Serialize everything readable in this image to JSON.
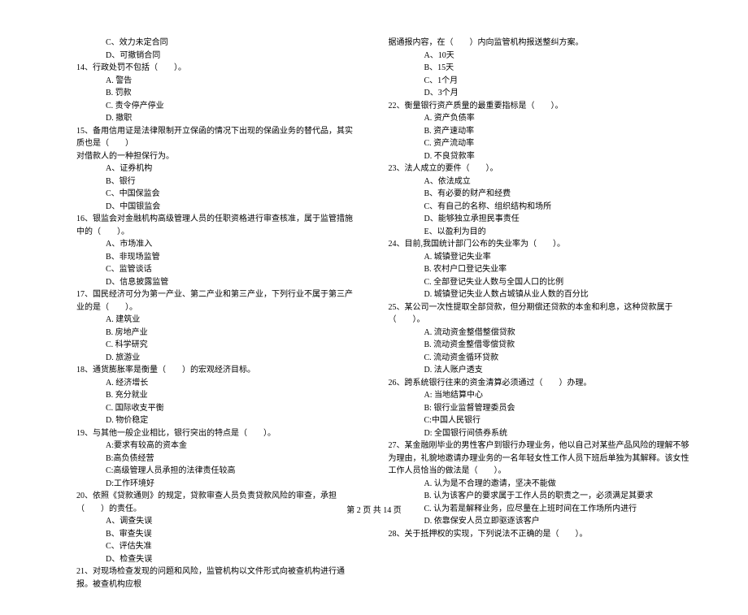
{
  "left": {
    "pre_opts": [
      "C、效力未定合同",
      "D、可撤销合同"
    ],
    "q14": {
      "text": "14、行政处罚不包括（　　）。",
      "opts": [
        "A. 警告",
        "B. 罚款",
        "C. 责令停产停业",
        "D. 撤职"
      ]
    },
    "q15": {
      "text": "15、备用信用证是法律限制开立保函的情况下出现的保函业务的替代品，其实质也是（　　）",
      "sub": "对借款人的一种担保行为。",
      "opts": [
        "A、证券机构",
        "B、银行",
        "C、中国保监会",
        "D、中国银监会"
      ]
    },
    "q16": {
      "text": "16、银监会对金融机构高级管理人员的任职资格进行审查核准，属于监管措施中的（　　）。",
      "opts": [
        "A、市场准入",
        "B、非现场监管",
        "C、监管谈话",
        "D、信息披露监管"
      ]
    },
    "q17": {
      "text": "17、国民经济可分为第一产业、第二产业和第三产业，下列行业不属于第三产业的是（　　）。",
      "opts": [
        "A. 建筑业",
        "B. 房地产业",
        "C. 科学研究",
        "D. 旅游业"
      ]
    },
    "q18": {
      "text": "18、通货膨胀率是衡量（　　）的宏观经济目标。",
      "opts": [
        "A. 经济增长",
        "B. 充分就业",
        "C. 国际收支平衡",
        "D. 物价稳定"
      ]
    },
    "q19": {
      "text": "19、与其他一般企业相比，银行突出的特点是（　　）。",
      "opts": [
        "A:要求有较高的资本金",
        "B:高负债经营",
        "C:高级管理人员承担的法律责任较高",
        "D:工作环境好"
      ]
    },
    "q20": {
      "text": "20、依照《贷款通则》的规定，贷款审查人员负责贷款风险的审查，承担（　　）的责任。",
      "opts": [
        "A、调查失误",
        "B、审查失误",
        "C、评估失准",
        "D、检查失误"
      ]
    },
    "q21": {
      "text": "21、对现场检查发现的问题和风险，监管机构以文件形式向被查机构进行通报。被查机构应根"
    }
  },
  "right": {
    "q21cont": {
      "text": "据通报内容，在（　　）内向监管机构报送整纠方案。",
      "opts": [
        "A、10天",
        "B、15天",
        "C、1个月",
        "D、3个月"
      ]
    },
    "q22": {
      "text": "22、衡量银行资产质量的最重要指标是（　　）。",
      "opts": [
        "A. 资产负债率",
        "B. 资产速动率",
        "C. 资产流动率",
        "D. 不良贷款率"
      ]
    },
    "q23": {
      "text": "23、法人成立的要件（　　）。",
      "opts": [
        "A、依法成立",
        "B、有必要的财产和经费",
        "C、有自己的名称、组织结构和场所",
        "D、能够独立承担民事责任",
        "E、以盈利为目的"
      ]
    },
    "q24": {
      "text": "24、目前,我国统计部门公布的失业率为（　　）。",
      "opts": [
        "A. 城镇登记失业率",
        "B. 农村户口登记失业率",
        "C. 全部登记失业人数与全国人口的比例",
        "D. 城镇登记失业人数占城镇从业人数的百分比"
      ]
    },
    "q25": {
      "text": "25、某公司一次性提取全部贷款，但分期偿还贷款的本金和利息，这种贷款属于（　　）。",
      "opts": [
        "A. 流动资金整借整偿贷款",
        "B. 流动资金整借零偿贷款",
        "C. 流动资金循环贷款",
        "D. 法人账户透支"
      ]
    },
    "q26": {
      "text": "26、跨系统银行往来的资金清算必须通过（　　）办理。",
      "opts": [
        "A: 当地结算中心",
        "B: 银行业监督管理委员会",
        "C:中国人民银行",
        "D: 全国银行间债券系统"
      ]
    },
    "q27": {
      "text": "27、某金融刚毕业的男性客户到银行办理业务，他以自己对某些产品风险的理解不够为理由，礼貌地邀请办理业务的一名年轻女性工作人员下班后单独为其解释。该女性工作人员恰当的做法是（　　）。",
      "opts": [
        "A. 认为是不合理的邀请，坚决不能做",
        "B. 认为该客户的要求属于工作人员的职责之一，必须满足其要求",
        "C. 认为若是解释业务，应尽量在上班时间在工作场所内进行",
        "D. 依靠保安人员立即驱逐该客户"
      ]
    },
    "q28": {
      "text": "28、关于抵押权的实现，下列说法不正确的是（　　）。"
    }
  },
  "footer": "第 2 页 共 14 页"
}
